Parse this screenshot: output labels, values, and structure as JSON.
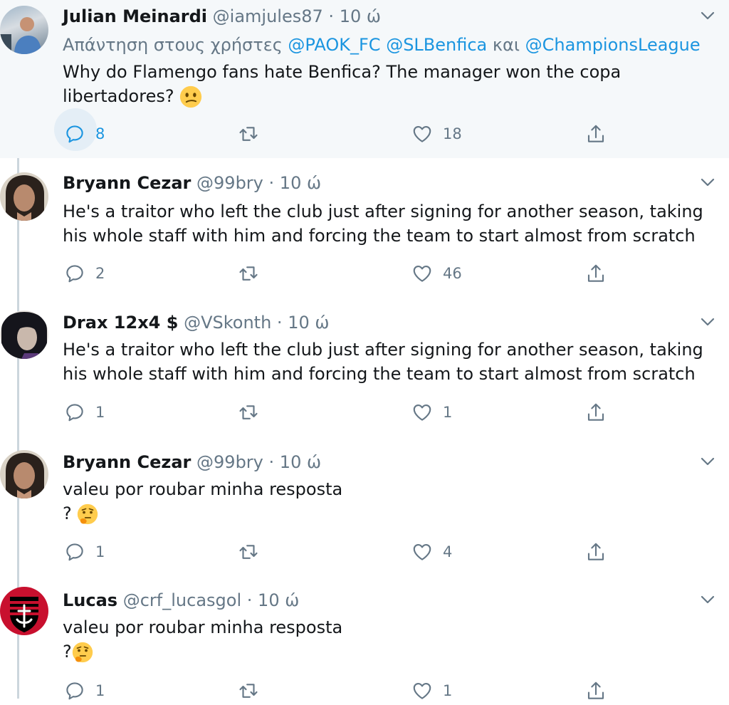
{
  "tweets": [
    {
      "name": "Julian Meinardi",
      "handle": "@iamjules87",
      "dot": "·",
      "time": "10 ώ",
      "reply_prefix": "Απάντηση στους χρήστες",
      "mention1": "@PAOK_FC",
      "mention2": "@SLBenfica",
      "and_word": "και",
      "mention3": "@ChampionsLeague",
      "line1": "Why do Flamengo fans hate Benfica? The manager won the copa",
      "line2": "libertadores?",
      "emoji": "confused-face",
      "replies": "8",
      "likes": "18"
    },
    {
      "name": "Bryann Cezar",
      "handle": "@99bry",
      "dot": "·",
      "time": "10 ώ",
      "line1": "He's a traitor who left the club just after signing for another season, taking",
      "line2": "his whole staff with him and forcing the team to start almost from scratch",
      "replies": "2",
      "likes": "46"
    },
    {
      "name": "Drax 12x4 $",
      "handle": "@VSkonth",
      "dot": "·",
      "time": "10 ώ",
      "line1": "He's a traitor who left the club just after signing for another season, taking",
      "line2": "his whole staff with him and forcing the team to start almost from scratch",
      "replies": "1",
      "likes": "1"
    },
    {
      "name": "Bryann Cezar",
      "handle": "@99bry",
      "dot": "·",
      "time": "10 ώ",
      "line1": "valeu por roubar minha resposta",
      "line2": "?",
      "emoji": "thinking-face",
      "replies": "1",
      "likes": "4"
    },
    {
      "name": "Lucas",
      "handle": "@crf_lucasgol",
      "dot": "·",
      "time": "10 ώ",
      "line1": "valeu por roubar minha resposta",
      "line2": "?",
      "emoji": "thinking-face",
      "replies": "1",
      "likes": "1"
    }
  ],
  "colors": {
    "name": "#14171a",
    "secondary": "#657786",
    "mention": "#1b95e0",
    "highlight_bg": "#f5f8fa",
    "thread_line": "#ccd6dd",
    "emoji_yellow": "#ffcc4d"
  },
  "icons": [
    "reply-icon",
    "retweet-icon",
    "like-icon",
    "share-icon",
    "chevron-down-icon"
  ]
}
